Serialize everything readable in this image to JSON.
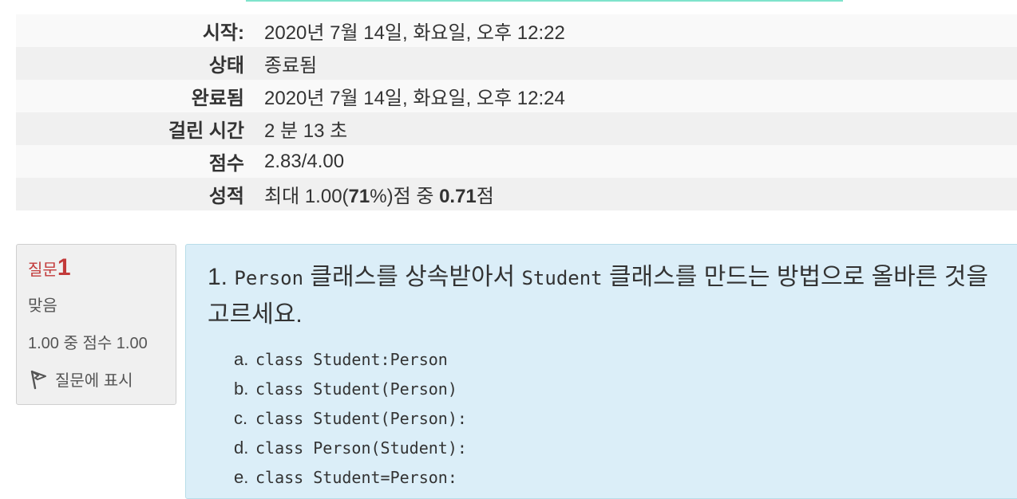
{
  "summary": {
    "rows": [
      {
        "label": "시작:",
        "value": "2020년 7월 14일, 화요일, 오후 12:22"
      },
      {
        "label": "상태",
        "value": "종료됨"
      },
      {
        "label": "완료됨",
        "value": "2020년 7월 14일, 화요일, 오후 12:24"
      },
      {
        "label": "걸린 시간",
        "value": "2 분 13 초"
      },
      {
        "label": "점수",
        "value": "2.83/4.00"
      }
    ],
    "grade_row": {
      "label": "성적",
      "prefix": "최대 1.00(",
      "percent": "71",
      "mid": "%)점 중 ",
      "score": "0.71",
      "suffix": "점"
    }
  },
  "question_info": {
    "qlabel": "질문",
    "qnum": "1",
    "state": "맞음",
    "grade": "1.00 중 점수 1.00",
    "flag_label": "질문에 표시"
  },
  "question": {
    "number": "1.",
    "parts": [
      "Person",
      " 클래스를 상속받아서 ",
      "Student",
      " 클래스를 만드는 방법으로 올바른 것을 고르세요."
    ],
    "answers": [
      {
        "letter": "a.",
        "code": "class Student:Person"
      },
      {
        "letter": "b.",
        "code": "class Student(Person)"
      },
      {
        "letter": "c.",
        "code": "class Student(Person):"
      },
      {
        "letter": "d.",
        "code": "class Person(Student):"
      },
      {
        "letter": "e.",
        "code": "class Student=Person:"
      }
    ]
  }
}
